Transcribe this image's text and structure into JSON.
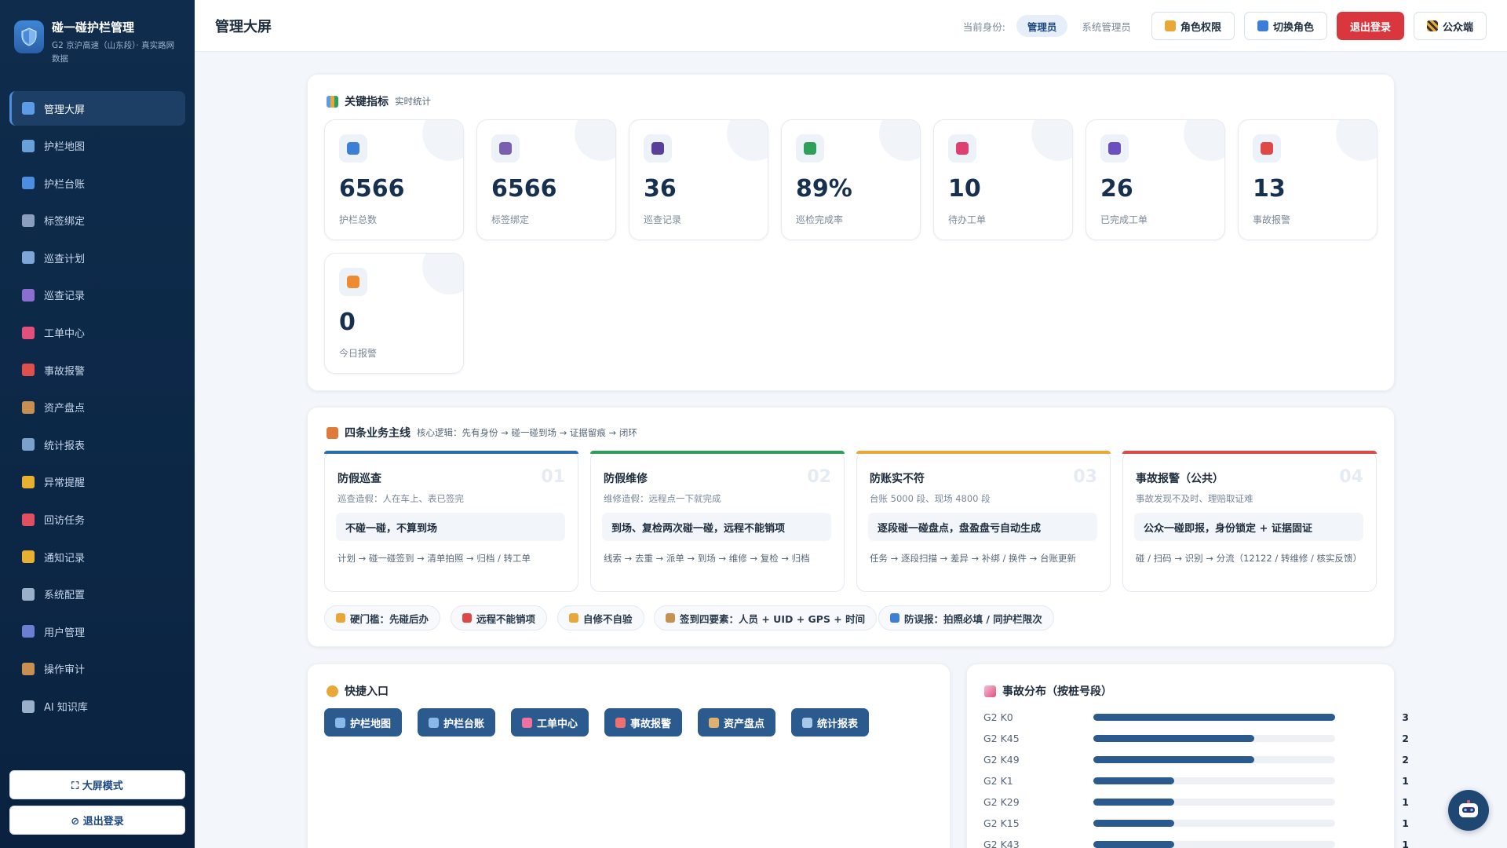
{
  "brand": {
    "title": "碰一碰护栏管理",
    "subtitle": "G2 京沪高速（山东段）· 真实路网数据"
  },
  "sidebar": {
    "items": [
      {
        "label": "管理大屏",
        "icon": "dashboard-icon",
        "color": "#5b9be8"
      },
      {
        "label": "护栏地图",
        "icon": "map-icon",
        "color": "#6aa0d8"
      },
      {
        "label": "护栏台账",
        "icon": "shield-icon",
        "color": "#4c8fe0"
      },
      {
        "label": "标签绑定",
        "icon": "tag-icon",
        "color": "#8a9fc0"
      },
      {
        "label": "巡查计划",
        "icon": "calendar-icon",
        "color": "#7fa6d6"
      },
      {
        "label": "巡查记录",
        "icon": "footprint-icon",
        "color": "#8a6fd0"
      },
      {
        "label": "工单中心",
        "icon": "toolbox-icon",
        "color": "#e0507a"
      },
      {
        "label": "事故报警",
        "icon": "siren-icon",
        "color": "#e0504a"
      },
      {
        "label": "资产盘点",
        "icon": "box-icon",
        "color": "#c89050"
      },
      {
        "label": "统计报表",
        "icon": "chart-icon",
        "color": "#7aa0cc"
      },
      {
        "label": "异常提醒",
        "icon": "warning-icon",
        "color": "#e8b030"
      },
      {
        "label": "回访任务",
        "icon": "phone-icon",
        "color": "#e05060"
      },
      {
        "label": "通知记录",
        "icon": "bell-icon",
        "color": "#e8b030"
      },
      {
        "label": "系统配置",
        "icon": "gear-icon",
        "color": "#9ab0c8"
      },
      {
        "label": "用户管理",
        "icon": "users-icon",
        "color": "#6a7fd0"
      },
      {
        "label": "操作审计",
        "icon": "scroll-icon",
        "color": "#c89050"
      },
      {
        "label": "AI 知识库",
        "icon": "robot-icon",
        "color": "#9ab0c8"
      }
    ],
    "big_screen_label": "⛶ 大屏模式",
    "logout_label": "⊘ 退出登录"
  },
  "header": {
    "title": "管理大屏",
    "identity_label": "当前身份:",
    "role_pill": "管理员",
    "role_name": "系统管理员",
    "btn_permissions": "角色权限",
    "btn_switch_role": "切换角色",
    "btn_logout": "退出登录",
    "btn_public": "公众端"
  },
  "metrics": {
    "title": "关键指标",
    "subtitle": "实时统计",
    "items": [
      {
        "value": "6566",
        "label": "护栏总数",
        "icon": "shield-icon",
        "color": "#3d7fd6"
      },
      {
        "value": "6566",
        "label": "标签绑定",
        "icon": "tag-icon",
        "color": "#7a5fb0"
      },
      {
        "value": "36",
        "label": "巡查记录",
        "icon": "footprint-icon",
        "color": "#5a3f9a"
      },
      {
        "value": "89%",
        "label": "巡检完成率",
        "icon": "check-box-icon",
        "color": "#2fa05a"
      },
      {
        "value": "10",
        "label": "待办工单",
        "icon": "toolbox-icon",
        "color": "#e04070"
      },
      {
        "value": "26",
        "label": "已完成工单",
        "icon": "check-icon",
        "color": "#6a4fc0"
      },
      {
        "value": "13",
        "label": "事故报警",
        "icon": "siren-icon",
        "color": "#e04848"
      },
      {
        "value": "0",
        "label": "今日报警",
        "icon": "lightning-icon",
        "color": "#f08a30"
      }
    ]
  },
  "flows": {
    "title": "四条业务主线",
    "subtitle": "核心逻辑：先有身份 → 碰一碰到场 → 证据留痕 → 闭环",
    "items": [
      {
        "title": "防假巡查",
        "num": "01",
        "desc": "巡查造假：人在车上、表已签完",
        "key": "不碰一碰，不算到场",
        "chain": "计划 → 碰一碰签到 → 清单拍照 → 归档 / 转工单",
        "color": "#2b6cb0"
      },
      {
        "title": "防假维修",
        "num": "02",
        "desc": "维修造假：远程点一下就完成",
        "key": "到场、复检两次碰一碰，远程不能销项",
        "chain": "线索 → 去重 → 派单 → 到场 → 维修 → 复检 → 归档",
        "color": "#2f9e5a"
      },
      {
        "title": "防账实不符",
        "num": "03",
        "desc": "台账 5000 段、现场 4800 段",
        "key": "逐段碰一碰盘点，盘盈盘亏自动生成",
        "chain": "任务 → 逐段扫描 → 差异 → 补绑 / 换件 → 台账更新",
        "color": "#e8a838"
      },
      {
        "title": "事故报警（公共）",
        "num": "04",
        "desc": "事故发现不及时、理赔取证难",
        "key": "公众一碰即报，身份锁定 + 证据固证",
        "chain": "碰 / 扫码 → 识别 → 分流（12122 / 转维修 / 核实反馈）",
        "color": "#d94a4a"
      }
    ],
    "chips": [
      {
        "label": "硬门槛：先碰后办",
        "icon": "lock-icon",
        "color": "#e8a838"
      },
      {
        "label": "远程不能销项",
        "icon": "forbidden-icon",
        "color": "#e04848"
      },
      {
        "label": "自修不自验",
        "icon": "person-icon",
        "color": "#e8a838"
      },
      {
        "label": "签到四要素：人员 + UID + GPS + 时间",
        "icon": "clipboard-icon",
        "color": "#c89050"
      },
      {
        "label": "防误报：拍照必填 / 同护栏限次",
        "icon": "shield-icon",
        "color": "#3d7fd6"
      }
    ]
  },
  "quick": {
    "title": "快捷入口",
    "buttons": [
      {
        "label": "护栏地图",
        "icon": "map-icon",
        "color": "#8ab8e8"
      },
      {
        "label": "护栏台账",
        "icon": "shield-icon",
        "color": "#8ab8e8"
      },
      {
        "label": "工单中心",
        "icon": "toolbox-icon",
        "color": "#f070a0"
      },
      {
        "label": "事故报警",
        "icon": "siren-icon",
        "color": "#f07070"
      },
      {
        "label": "资产盘点",
        "icon": "box-icon",
        "color": "#e0b070"
      },
      {
        "label": "统计报表",
        "icon": "chart-icon",
        "color": "#a8c8e8"
      }
    ]
  },
  "distribution": {
    "title": "事故分布（按桩号段）",
    "max": 3,
    "rows": [
      {
        "label": "G2 K0",
        "value": 3
      },
      {
        "label": "G2 K45",
        "value": 2
      },
      {
        "label": "G2 K49",
        "value": 2
      },
      {
        "label": "G2 K1",
        "value": 1
      },
      {
        "label": "G2 K29",
        "value": 1
      },
      {
        "label": "G2 K15",
        "value": 1
      },
      {
        "label": "G2 K43",
        "value": 1
      }
    ]
  }
}
